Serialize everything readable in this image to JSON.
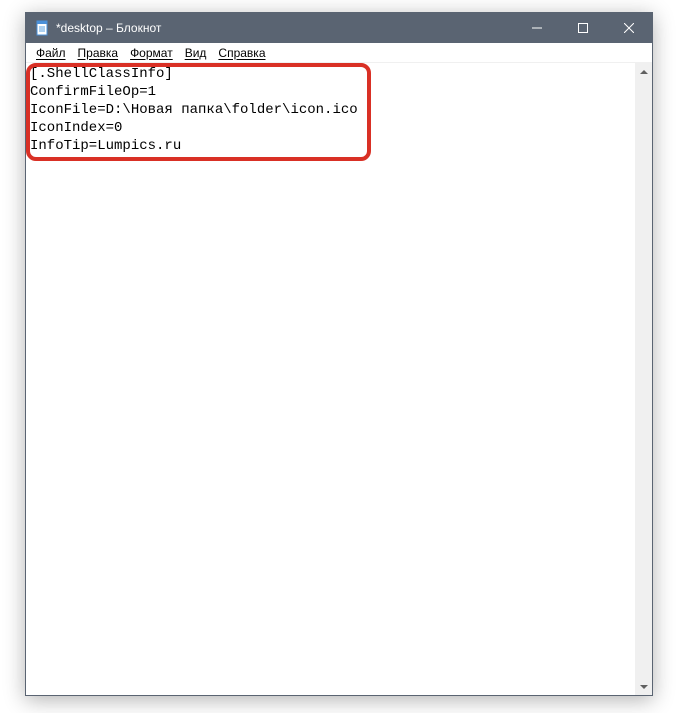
{
  "titlebar": {
    "title": "*desktop – Блокнот"
  },
  "menubar": {
    "items": [
      "Файл",
      "Правка",
      "Формат",
      "Вид",
      "Справка"
    ]
  },
  "content": {
    "line1": "[.ShellClassInfo]",
    "line2": "ConfirmFileOp=1",
    "line3": "IconFile=D:\\Новая папка\\folder\\icon.ico",
    "line4": "IconIndex=0",
    "line5": "InfoTip=Lumpics.ru"
  },
  "icons": {
    "minimize": "─",
    "maximize": "☐",
    "close": "✕",
    "arrowUp": "▲",
    "arrowDown": "▼"
  }
}
